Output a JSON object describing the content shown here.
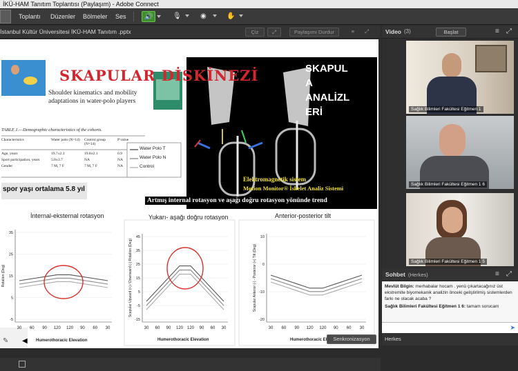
{
  "window": {
    "title": "İKÜ-HAM Tanıtım Toplantısı (Paylaşım) - Adobe Connect"
  },
  "menu": {
    "items": [
      "Toplantı",
      "Düzenler",
      "Bölmeler",
      "Ses"
    ]
  },
  "share_pod": {
    "title": "İstanbul Kültür Üniversitesi İKÜ-HAM Tanıtım .pptx",
    "draw_label": "Çiz",
    "stop_share_label": "Paylaşımı Durdur",
    "sync_label": "Senkronizasyon"
  },
  "slide": {
    "heading": "SKAPULAR DİSKİNEZİ",
    "paper_title": "Shoulder kinematics and mobility adaptations in water-polo players",
    "table_caption": "TABLE 1.—Demographic characteristics of the cohorts.",
    "table_headers": [
      "Characteristics",
      "Water polo (N=14)",
      "Control group (N=14)",
      "P value"
    ],
    "table_rows": [
      [
        "Age, years",
        "19.7±2.3",
        "19.8±2.1",
        "0.9"
      ],
      [
        "Sport participation, years",
        "5.8±3.7",
        "NA",
        "NA"
      ],
      [
        "Gender",
        "7 M, 7 F",
        "7 M, 7 F",
        "NA"
      ]
    ],
    "legend": [
      "Water Polo T",
      "Water Polo N",
      "Control"
    ],
    "average_note": "spor yaşı ortalama 5.8 yıl",
    "analysis_title": "SKAPULA ANALİZLERİ",
    "analysis_lines": [
      "SKAPUL",
      "A",
      "ANALİZL",
      "ERİ"
    ],
    "system_line1": "Elektromagnetik sistem",
    "system_line2": "Motion Monitor® İskelet Analiz Sistemi",
    "trend_text": "Artmış internal rotasyon ve aşağı doğru rotasyon yönünde trend",
    "charts": [
      {
        "title": "İnternal-eksternal rotasyon",
        "ylabel": "Rotation (Deg)",
        "xlabel": "Humerothoracic Elevation",
        "xticks": [
          "30",
          "60",
          "90",
          "120",
          "120",
          "90",
          "60",
          "30"
        ],
        "yticks": [
          "35",
          "25",
          "15",
          "5",
          "-5"
        ]
      },
      {
        "title": "Yukarı- aşağı doğru rotasyon",
        "ylabel": "Scapular Upward (+) / Downward (-) Rotation (Deg)",
        "xlabel": "Humerothoracic Elevation",
        "xticks": [
          "30",
          "60",
          "90",
          "120",
          "120",
          "90",
          "60",
          "30"
        ],
        "yticks": [
          "45",
          "35",
          "25",
          "15",
          "5",
          "-5",
          "-15"
        ]
      },
      {
        "title": "Anterior-posterior tilt",
        "ylabel": "Scapular Anterior (-) - Posterior (+) Tilt (Deg)",
        "xlabel": "Humerothoracic Elevation",
        "xticks": [
          "30",
          "60",
          "90",
          "120",
          "120",
          "90",
          "60",
          "30"
        ],
        "yticks": [
          "10",
          "0",
          "-10",
          "-20"
        ]
      }
    ]
  },
  "video_pod": {
    "title": "Video",
    "count": "(3)",
    "start_label": "Başlat",
    "participants": [
      "Sağlık Bilimleri Fakültesi Eğitmen 1",
      "Sağlık Bilimleri Fakültesi Eğitmen 1 6",
      "Sağlık Bilimleri Fakültesi Eğitmen 1 5"
    ]
  },
  "chat_pod": {
    "title": "Sohbet",
    "scope": "(Herkes)",
    "messages": [
      {
        "sender": "Mevlüt Bilgin:",
        "text": "merhabalar hocam . yenü çıkartacağınız üst ekstremite biyomekanik analizin önceki geliştirilmiş sistemlerden farkı ne olacak acaba ?"
      },
      {
        "sender": "Sağlık Bilimleri Fakültesi Eğitmen 1 6:",
        "text": "tamam sorucam"
      }
    ],
    "recipient_tab": "Herkes"
  },
  "colors": {
    "accent_green": "#3f8f2e",
    "heading_red": "#d4262e",
    "chart_circle": "#d9322b",
    "trend_bar": "#1a1a7a"
  }
}
